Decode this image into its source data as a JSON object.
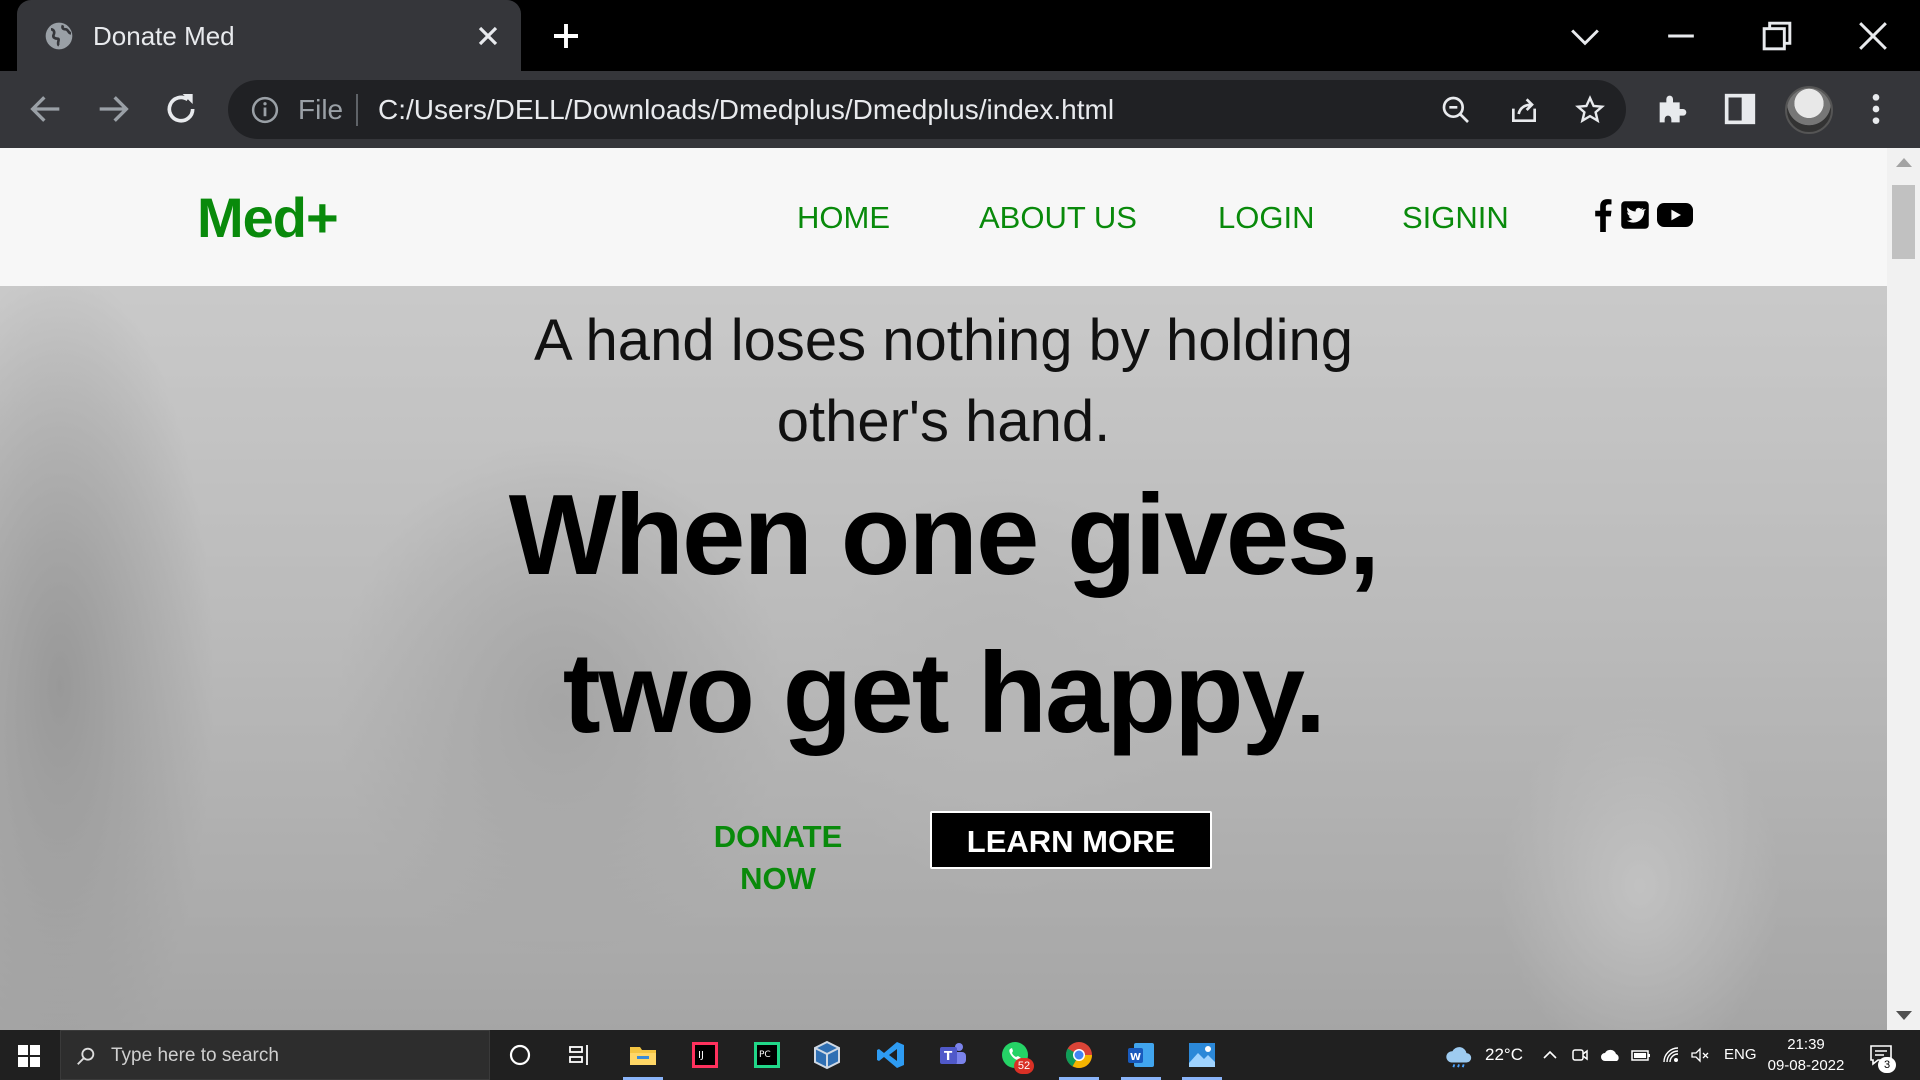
{
  "browser": {
    "tab_title": "Donate Med",
    "omnibox_scheme": "File",
    "url": "C:/Users/DELL/Downloads/Dmedplus/Dmedplus/index.html"
  },
  "site": {
    "logo": "Med+",
    "nav": [
      "HOME",
      "ABOUT US",
      "LOGIN",
      "SIGNIN"
    ],
    "social_icons": [
      "facebook-icon",
      "twitter-icon",
      "youtube-icon"
    ]
  },
  "hero": {
    "subtitle_line1": "A hand loses nothing by holding",
    "subtitle_line2": "other's hand.",
    "title_line1": "When one gives,",
    "title_line2": "two get happy.",
    "donate_label": "DONATE NOW",
    "learn_label": "LEARN MORE"
  },
  "taskbar": {
    "search_placeholder": "Type here to search",
    "weather": "22°C",
    "language": "ENG",
    "time": "21:39",
    "date": "09-08-2022",
    "whatsapp_badge": "52",
    "notification_badge": "3"
  },
  "colors": {
    "brand_green": "#098a0b",
    "chrome_dark": "#35363a",
    "omnibox": "#202124"
  }
}
